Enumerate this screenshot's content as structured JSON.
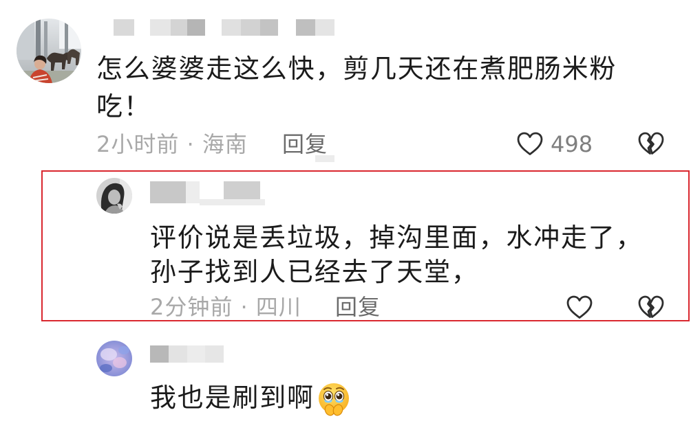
{
  "theme": {
    "background": "#ffffff",
    "text_color": "#1b1b1b",
    "meta_color": "#a8a8a8",
    "reply_color": "#6b6b6b",
    "count_color": "#7f7f7f",
    "icon_color": "#2e2e2e",
    "highlight_border_color": "#d9262e"
  },
  "icons": {
    "like": "heart-outline-icon",
    "dislike": "broken-heart-icon"
  },
  "comments": [
    {
      "text": "怎么婆婆走这么快，剪几天还在煮肥肠米粉吃！",
      "time": "2小时前",
      "separator": "·",
      "location": "海南",
      "reply_label": "回复",
      "like_count": "498"
    },
    {
      "text": "评价说是丢垃圾，掉沟里面，水冲走了，孙子找到人已经去了天堂，",
      "time": "2分钟前",
      "separator": "·",
      "location": "四川",
      "reply_label": "回复",
      "highlighted": true
    },
    {
      "text": "我也是刷到啊",
      "emoji": "pleading-face-holding-hands-emoji"
    }
  ]
}
